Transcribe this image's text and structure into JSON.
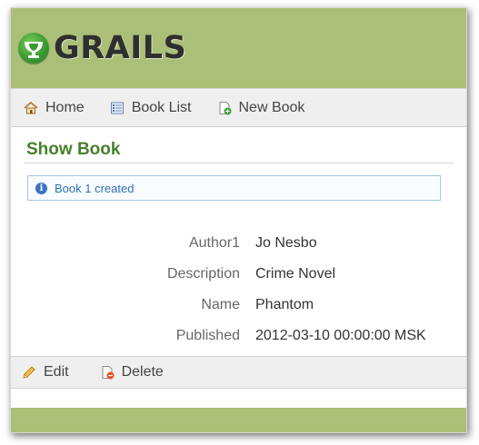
{
  "brand": {
    "logo_text": "GRAILS"
  },
  "nav": {
    "items": [
      {
        "label": "Home",
        "icon": "home-icon"
      },
      {
        "label": "Book List",
        "icon": "list-icon"
      },
      {
        "label": "New Book",
        "icon": "new-document-icon"
      }
    ]
  },
  "page": {
    "title": "Show Book",
    "message": "Book 1 created"
  },
  "book": {
    "fields": [
      {
        "label": "Author1",
        "value": "Jo Nesbo"
      },
      {
        "label": "Description",
        "value": "Crime Novel"
      },
      {
        "label": "Name",
        "value": "Phantom"
      },
      {
        "label": "Published",
        "value": "2012-03-10 00:00:00 MSK"
      }
    ]
  },
  "actions": {
    "edit_label": "Edit",
    "delete_label": "Delete"
  },
  "colors": {
    "header_bg": "#abbf78",
    "title_color": "#48802c",
    "message_border": "#a7c6e0",
    "message_text": "#2a6fb6"
  }
}
